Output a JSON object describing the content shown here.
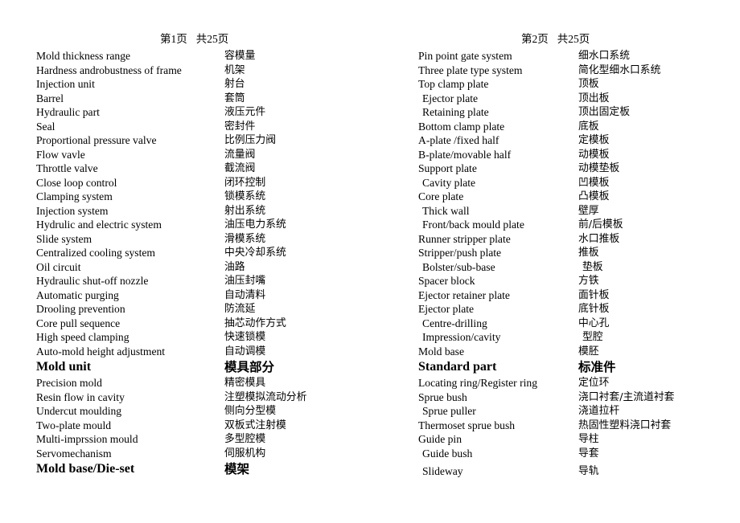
{
  "document": {
    "pages": [
      {
        "header": {
          "page_label": "第1页",
          "total_label": "共25页"
        },
        "columns": {
          "english_header": "",
          "chinese_header": ""
        },
        "rows": [
          {
            "en": "Mold thickness range",
            "zh": "容模量"
          },
          {
            "en": "Hardness androbustness of frame",
            "zh": "机架"
          },
          {
            "en": "Injection unit",
            "zh": "射台"
          },
          {
            "en": "Barrel",
            "zh": "套筒"
          },
          {
            "en": "Hydraulic part",
            "zh": "液压元件"
          },
          {
            "en": "Seal",
            "zh": "密封件"
          },
          {
            "en": "Proportional pressure valve",
            "zh": "比例压力阀"
          },
          {
            "en": "Flow vavle",
            "zh": "流量阀"
          },
          {
            "en": "Throttle valve",
            "zh": "截流阀"
          },
          {
            "en": "Close loop control",
            "zh": "闭环控制"
          },
          {
            "en": "Clamping system",
            "zh": "锁模系统"
          },
          {
            "en": "Injection system",
            "zh": "射出系统"
          },
          {
            "en": "Hydrulic and electric system",
            "zh": "油压电力系统"
          },
          {
            "en": "Slide system",
            "zh": "滑模系统"
          },
          {
            "en": "Centralized cooling system",
            "zh": "中央冷却系统"
          },
          {
            "en": "Oil circuit",
            "zh": "油路"
          },
          {
            "en": "Hydraulic shut-off nozzle",
            "zh": "油压封嘴"
          },
          {
            "en": "Automatic purging",
            "zh": "自动清料"
          },
          {
            "en": "Drooling prevention",
            "zh": "防流延"
          },
          {
            "en": "Core pull sequence",
            "zh": "抽芯动作方式"
          },
          {
            "en": "High speed clamping",
            "zh": "快速锁模"
          },
          {
            "en": "Auto-mold height adjustment",
            "zh": "自动调模"
          },
          {
            "en": "Mold unit",
            "zh": "模具部分",
            "heading": true
          },
          {
            "en": "Precision mold",
            "zh": "精密模具"
          },
          {
            "en": "Resin flow in cavity",
            "zh": "注塑模拟流动分析"
          },
          {
            "en": "Undercut moulding",
            "zh": "侧向分型模"
          },
          {
            "en": "Two-plate mould",
            "zh": "双板式注射模"
          },
          {
            "en": "Multi-imprssion mould",
            "zh": "多型腔模"
          },
          {
            "en": "Servomechanism",
            "zh": "伺服机构"
          },
          {
            "en": "Mold base/Die-set",
            "zh": "模架",
            "heading": true
          }
        ]
      },
      {
        "header": {
          "page_label": "第2页",
          "total_label": "共25页"
        },
        "columns": {
          "english_header": "",
          "chinese_header": ""
        },
        "rows": [
          {
            "en": "Pin point gate system",
            "zh": "细水口系统"
          },
          {
            "en": "Three plate type system",
            "zh": "简化型细水口系统"
          },
          {
            "en": "Top clamp plate",
            "zh": "顶板"
          },
          {
            "en": "Ejector plate",
            "zh": "顶出板",
            "indent_en": true
          },
          {
            "en": "Retaining plate",
            "zh": "顶出固定板",
            "indent_en": true
          },
          {
            "en": "Bottom clamp plate",
            "zh": "底板"
          },
          {
            "en": "A-plate /fixed half",
            "zh": "定模板"
          },
          {
            "en": "B-plate/movable half",
            "zh": "动模板"
          },
          {
            "en": "Support plate",
            "zh": "动模垫板"
          },
          {
            "en": "Cavity plate",
            "zh": "凹模板",
            "indent_en": true
          },
          {
            "en": "Core plate",
            "zh": "凸模板"
          },
          {
            "en": "Thick wall",
            "zh": "壁厚",
            "indent_en": true
          },
          {
            "en": "Front/back mould plate",
            "zh": "前/后模板",
            "indent_en": true
          },
          {
            "en": "Runner stripper plate",
            "zh": "水口推板"
          },
          {
            "en": "Stripper/push plate",
            "zh": "推板"
          },
          {
            "en": "Bolster/sub-base",
            "zh": "垫板",
            "indent_en": true,
            "indent_zh": true
          },
          {
            "en": "Spacer block",
            "zh": "方铁"
          },
          {
            "en": "Ejector retainer plate",
            "zh": "面针板"
          },
          {
            "en": "Ejector plate",
            "zh": "底针板"
          },
          {
            "en": "Centre-drilling",
            "zh": "中心孔",
            "indent_en": true
          },
          {
            "en": "Impression/cavity",
            "zh": "型腔",
            "indent_en": true,
            "indent_zh": true
          },
          {
            "en": "Mold base",
            "zh": "模胚"
          },
          {
            "en": "Standard part",
            "zh": "标准件",
            "heading": true
          },
          {
            "en": "Locating ring/Register ring",
            "zh": "定位环"
          },
          {
            "en": "Sprue bush",
            "zh": "浇口衬套/主流道衬套"
          },
          {
            "en": "Sprue puller",
            "zh": "浇道拉杆",
            "indent_en": true
          },
          {
            "en": "Thermoset sprue bush",
            "zh": "热固性塑料浇口衬套"
          },
          {
            "en": "Guide pin",
            "zh": "导柱"
          },
          {
            "en": "Guide bush",
            "zh": "导套",
            "indent_en": true
          },
          {
            "en": "Slideway",
            "zh": "导轨",
            "indent_en": true,
            "gap_before": true
          }
        ]
      }
    ]
  },
  "colors": {
    "text": "#000000",
    "background": "#ffffff"
  }
}
